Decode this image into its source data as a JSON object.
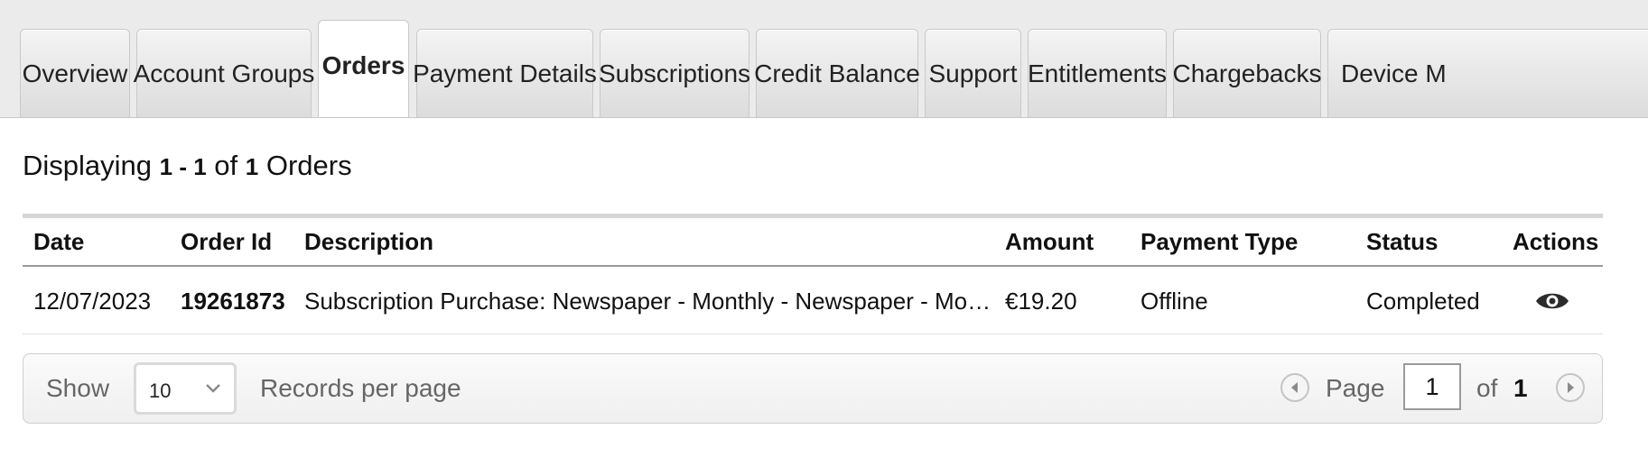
{
  "tabs": [
    {
      "label": "Overview"
    },
    {
      "label": "Account Groups"
    },
    {
      "label": "Orders"
    },
    {
      "label": "Payment Details"
    },
    {
      "label": "Subscriptions"
    },
    {
      "label": "Credit Balance"
    },
    {
      "label": "Support"
    },
    {
      "label": "Entitlements"
    },
    {
      "label": "Chargebacks"
    },
    {
      "label": "Device M"
    }
  ],
  "summary": {
    "prefix": "Displaying",
    "range": "1 - 1",
    "of": "of",
    "total": "1",
    "suffix": "Orders"
  },
  "table": {
    "columns": [
      "Date",
      "Order Id",
      "Description",
      "Amount",
      "Payment Type",
      "Status",
      "Actions"
    ],
    "rows": [
      {
        "date": "12/07/2023",
        "order_id": "19261873",
        "description": "Subscription Purchase: Newspaper - Monthly - Newspaper - Monthly",
        "amount": "€19.20",
        "payment_type": "Offline",
        "status": "Completed",
        "action_icon": "eye-icon"
      }
    ]
  },
  "pager": {
    "show_label": "Show",
    "per_page": "10",
    "records_label": "Records per page",
    "page_label": "Page",
    "current_page": "1",
    "of_label": "of",
    "total_pages": "1"
  }
}
